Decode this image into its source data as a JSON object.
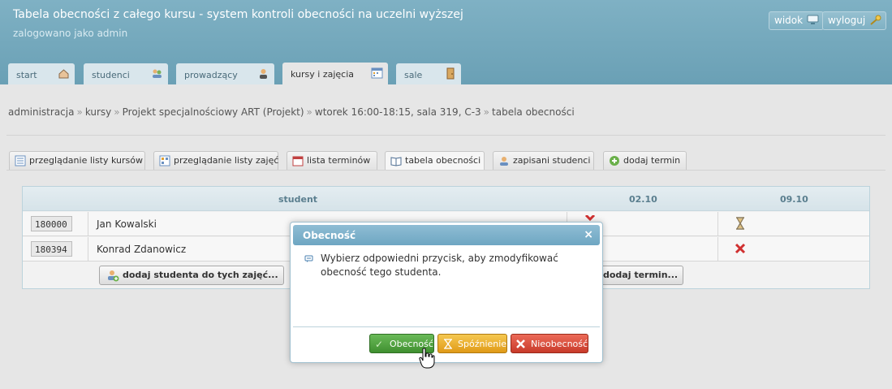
{
  "header": {
    "title": "Tabela obecności z całego kursu - system kontroli obecności na uczelni wyższej",
    "subtitle": "zalogowano jako admin",
    "buttons": [
      {
        "label": "widok",
        "icon": "monitor-icon"
      },
      {
        "label": "wyloguj",
        "icon": "key-icon"
      }
    ]
  },
  "main_tabs": [
    {
      "label": "start",
      "icon": "home-icon"
    },
    {
      "label": "studenci",
      "icon": "users-icon"
    },
    {
      "label": "prowadzący",
      "icon": "teacher-icon"
    },
    {
      "label": "kursy i zajęcia",
      "icon": "calendar-icon",
      "active": true
    },
    {
      "label": "sale",
      "icon": "door-icon"
    }
  ],
  "breadcrumb": [
    "administracja",
    "kursy",
    "Projekt specjalnościowy ART (Projekt)",
    "wtorek 16:00-18:15, sala 319, C-3",
    "tabela obecności"
  ],
  "breadcrumb_sep": "»",
  "sub_tabs": [
    {
      "label": "przeglądanie listy kursów",
      "icon": "list-icon"
    },
    {
      "label": "przeglądanie listy zajęć",
      "icon": "grid-icon"
    },
    {
      "label": "lista terminów",
      "icon": "calendar-icon"
    },
    {
      "label": "tabela obecności",
      "icon": "book-icon",
      "active": true
    },
    {
      "label": "zapisani studenci",
      "icon": "user-icon"
    },
    {
      "label": "dodaj termin",
      "icon": "add-icon"
    }
  ],
  "table": {
    "columns": [
      "student",
      "02.10",
      "09.10"
    ],
    "rows": [
      {
        "id": "180000",
        "name": "Jan Kowalski",
        "marks": [
          "absent",
          "late"
        ]
      },
      {
        "id": "180394",
        "name": "Konrad Zdanowicz",
        "marks": [
          "",
          "absent"
        ]
      }
    ],
    "add_student_label": "dodaj studenta do tych zajęć...",
    "add_term_label": "dodaj termin..."
  },
  "dialog": {
    "title": "Obecność",
    "close": "×",
    "message": "Wybierz odpowiedni przycisk, aby zmodyfikować obecność tego studenta.",
    "buttons": {
      "present": "Obecność",
      "late": "Spóźnienie",
      "absent": "Nieobecność"
    }
  },
  "colors": {
    "header_bg": "#6aa0b5",
    "present_btn": "#4a9a3a",
    "late_btn": "#e5a51a",
    "absent_btn": "#d84a3a",
    "absent_mark": "#d03030"
  }
}
